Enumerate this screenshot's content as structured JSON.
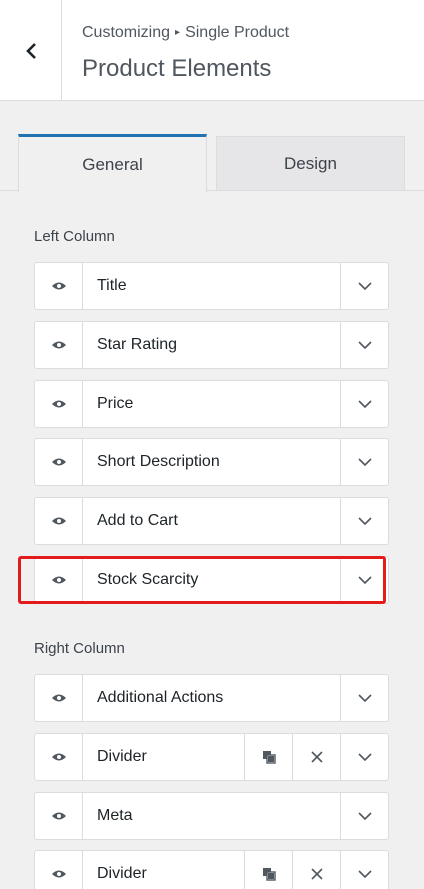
{
  "header": {
    "breadcrumb_part1": "Customizing",
    "breadcrumb_sep": "▸",
    "breadcrumb_part2": "Single Product",
    "title": "Product Elements"
  },
  "tabs": [
    {
      "label": "General",
      "active": true
    },
    {
      "label": "Design",
      "active": false
    }
  ],
  "left_column": {
    "label": "Left Column",
    "items": [
      {
        "label": "Title"
      },
      {
        "label": "Star Rating"
      },
      {
        "label": "Price"
      },
      {
        "label": "Short Description"
      },
      {
        "label": "Add to Cart"
      },
      {
        "label": "Stock Scarcity",
        "highlighted": true
      }
    ]
  },
  "right_column": {
    "label": "Right Column",
    "items": [
      {
        "label": "Additional Actions"
      },
      {
        "label": "Divider",
        "has_duplicate": true,
        "has_remove": true
      },
      {
        "label": "Meta"
      },
      {
        "label": "Divider",
        "has_duplicate": true,
        "has_remove": true
      }
    ]
  },
  "icons": {
    "back": "chevron-left-icon",
    "visibility": "eye-icon",
    "expand": "chevron-down-icon",
    "duplicate": "duplicate-icon",
    "remove": "close-icon"
  },
  "colors": {
    "accent": "#2271b1",
    "highlight": "#e31b1b",
    "background": "#f0f0f1"
  }
}
